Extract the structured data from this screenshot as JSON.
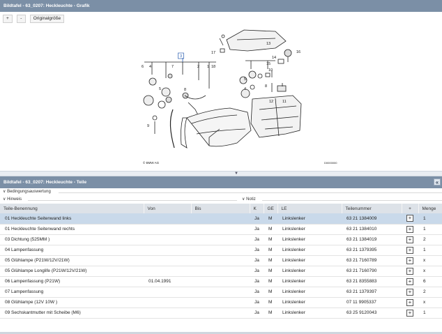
{
  "graphic_panel": {
    "title": "Bildtafel - 63_0207: Heckleuchte - Grafik",
    "toolbar": {
      "zoom_in": "+",
      "zoom_out": "-",
      "original_size": "Originalgröße"
    },
    "diagram": {
      "callouts": [
        "1",
        "2",
        "3",
        "4",
        "5",
        "6",
        "7",
        "8",
        "9",
        "10",
        "11",
        "12",
        "13",
        "14",
        "15",
        "16",
        "17",
        "18"
      ],
      "copyright": "© BMW AG",
      "image_code": "D0000000"
    }
  },
  "parts_panel": {
    "title": "Bildtafel - 63_0207: Heckleuchte - Teile",
    "collapse_icon": "«",
    "section_conditions": "Bedingungsauswertung",
    "section_hint": "Hinweis",
    "section_note": "Notiz",
    "columns": [
      "Teile-Benennung",
      "Von",
      "Bis",
      "K",
      "GE",
      "LE",
      "Teilenummer",
      "+",
      "Menge"
    ],
    "rows": [
      {
        "name": "01 Heckleuchte Seitenwand links",
        "von": "",
        "bis": "",
        "k": "Ja",
        "ge": "M",
        "le": "Linkslenker",
        "teilenummer": "63 21 1384009",
        "menge": "1",
        "selected": true
      },
      {
        "name": "01 Heckleuchte Seitenwand rechts",
        "von": "",
        "bis": "",
        "k": "Ja",
        "ge": "M",
        "le": "Linkslenker",
        "teilenummer": "63 21 1384010",
        "menge": "1",
        "selected": false
      },
      {
        "name": "03 Dichtung (525MM )",
        "von": "",
        "bis": "",
        "k": "Ja",
        "ge": "M",
        "le": "Linkslenker",
        "teilenummer": "63 21 1384019",
        "menge": "2",
        "selected": false
      },
      {
        "name": "04 Lampenfassung",
        "von": "",
        "bis": "",
        "k": "Ja",
        "ge": "M",
        "le": "Linkslenker",
        "teilenummer": "63 21 1379395",
        "menge": "1",
        "selected": false
      },
      {
        "name": "05 Glühlampe (P21W/12V/21W)",
        "von": "",
        "bis": "",
        "k": "Ja",
        "ge": "M",
        "le": "Linkslenker",
        "teilenummer": "63 21 7160789",
        "menge": "x",
        "selected": false
      },
      {
        "name": "05 Glühlampe Longlife (P21W/12V/21W)",
        "von": "",
        "bis": "",
        "k": "Ja",
        "ge": "M",
        "le": "Linkslenker",
        "teilenummer": "63 21 7160790",
        "menge": "x",
        "selected": false
      },
      {
        "name": "06 Lampenfassung (P21W)",
        "von": "01.04.1991",
        "bis": "",
        "k": "Ja",
        "ge": "M",
        "le": "Linkslenker",
        "teilenummer": "63 21 8355883",
        "menge": "6",
        "selected": false
      },
      {
        "name": "07 Lampenfassung",
        "von": "",
        "bis": "",
        "k": "Ja",
        "ge": "M",
        "le": "Linkslenker",
        "teilenummer": "63 21 1379397",
        "menge": "2",
        "selected": false
      },
      {
        "name": "08 Glühlampe (12V 10W )",
        "von": "",
        "bis": "",
        "k": "Ja",
        "ge": "M",
        "le": "Linkslenker",
        "teilenummer": "07 11 9905337",
        "menge": "x",
        "selected": false
      },
      {
        "name": "09 Sechskantmutter mit Scheibe (M6)",
        "von": "",
        "bis": "",
        "k": "Ja",
        "ge": "M",
        "le": "Linkslenker",
        "teilenummer": "63 25 9120043",
        "menge": "1",
        "selected": false
      }
    ]
  },
  "colors": {
    "header": "#7b8fa6",
    "selected_row": "#c9d9ea",
    "table_header": "#dde2e8",
    "callout_highlight": "#2a5db0"
  }
}
